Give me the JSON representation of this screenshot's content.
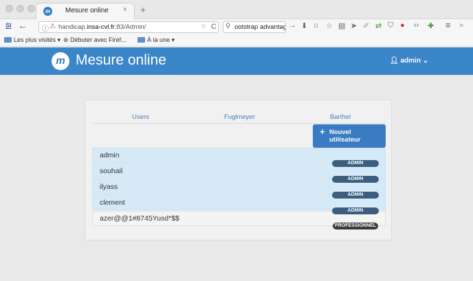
{
  "browser": {
    "tab_title": "Mesure online",
    "tab_close": "×",
    "new_tab": "+",
    "url_prefix": "handicap.",
    "url_domain": "insa-cvl.fr",
    "url_suffix": ":83/Admin/",
    "search_text": "ootstrap advantages",
    "bookmarks": [
      {
        "label": "Les plus visités ▾"
      },
      {
        "label": "Débuter avec Firef..."
      },
      {
        "label": "À la une ▾"
      }
    ]
  },
  "app": {
    "logo_letter": "m",
    "title": "Mesure online",
    "user": "admin"
  },
  "tabs": [
    "Users",
    "Fuglmeyer",
    "Barthel"
  ],
  "add_button": {
    "plus": "+",
    "line1": "Nouvel",
    "line2": "utilisateur"
  },
  "users": [
    {
      "name": "admin",
      "role": "ADMIN"
    },
    {
      "name": "souhail",
      "role": "ADMIN"
    },
    {
      "name": "ilyass",
      "role": "ADMIN"
    },
    {
      "name": "clement",
      "role": "ADMIN"
    },
    {
      "name": "azer@@1#8745Yusd*$$",
      "role": "PROFESSIONNEL"
    }
  ]
}
